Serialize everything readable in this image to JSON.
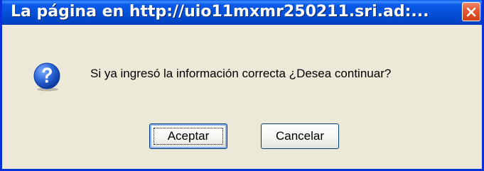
{
  "window": {
    "title": "La página en http://uio11mxmr250211.sri.ad:..."
  },
  "dialog": {
    "message": "Si ya ingresó la información correcta ¿Desea continuar?",
    "icon": "question-icon",
    "buttons": {
      "accept_label": "Aceptar",
      "cancel_label": "Cancelar"
    }
  },
  "colors": {
    "titlebar": "#0550d8",
    "frame": "#0831d9",
    "dialog_bg": "#ece9d8",
    "close_button": "#e35a34",
    "question_icon": "#2c67d8"
  }
}
